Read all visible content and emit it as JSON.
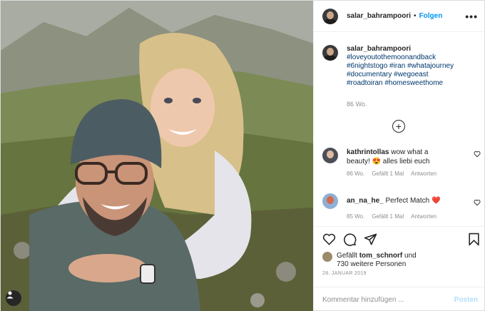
{
  "post": {
    "username": "salar_bahrampoori",
    "separator": "•",
    "follow_label": "Folgen",
    "more_label": "•••"
  },
  "caption": {
    "username": "salar_bahrampoori",
    "hashtags": "#loveyoutothemoonandback\n#6nightstogo #iran #whatajourney\n#documentary #wegoeast\n#roadtoiran #homesweethome",
    "time": "86 Wo."
  },
  "load_more_label": "+",
  "comments": [
    {
      "username": "kathrintollas",
      "text": "wow what a beauty! 😍 alles liebi euch",
      "time": "86 Wo.",
      "likes": "Gefällt 1 Mal",
      "reply": "Antworten"
    },
    {
      "username": "an_na_he_",
      "text": "Perfect Match ❤️",
      "time": "85 Wo.",
      "likes": "Gefällt 1 Mal",
      "reply": "Antworten"
    }
  ],
  "likes": {
    "prefix": "Gefällt ",
    "user": "tom_schnorf",
    "suffix": " und",
    "others": "730 weitere Personen"
  },
  "date": "28. JANUAR 2019",
  "comment_input": {
    "placeholder": "Kommentar hinzufügen ...",
    "submit_label": "Posten"
  },
  "colors": {
    "link": "#0095f6",
    "hashtag": "#00376b",
    "muted": "#8e8e8e",
    "post_disabled": "#b2dffc"
  }
}
